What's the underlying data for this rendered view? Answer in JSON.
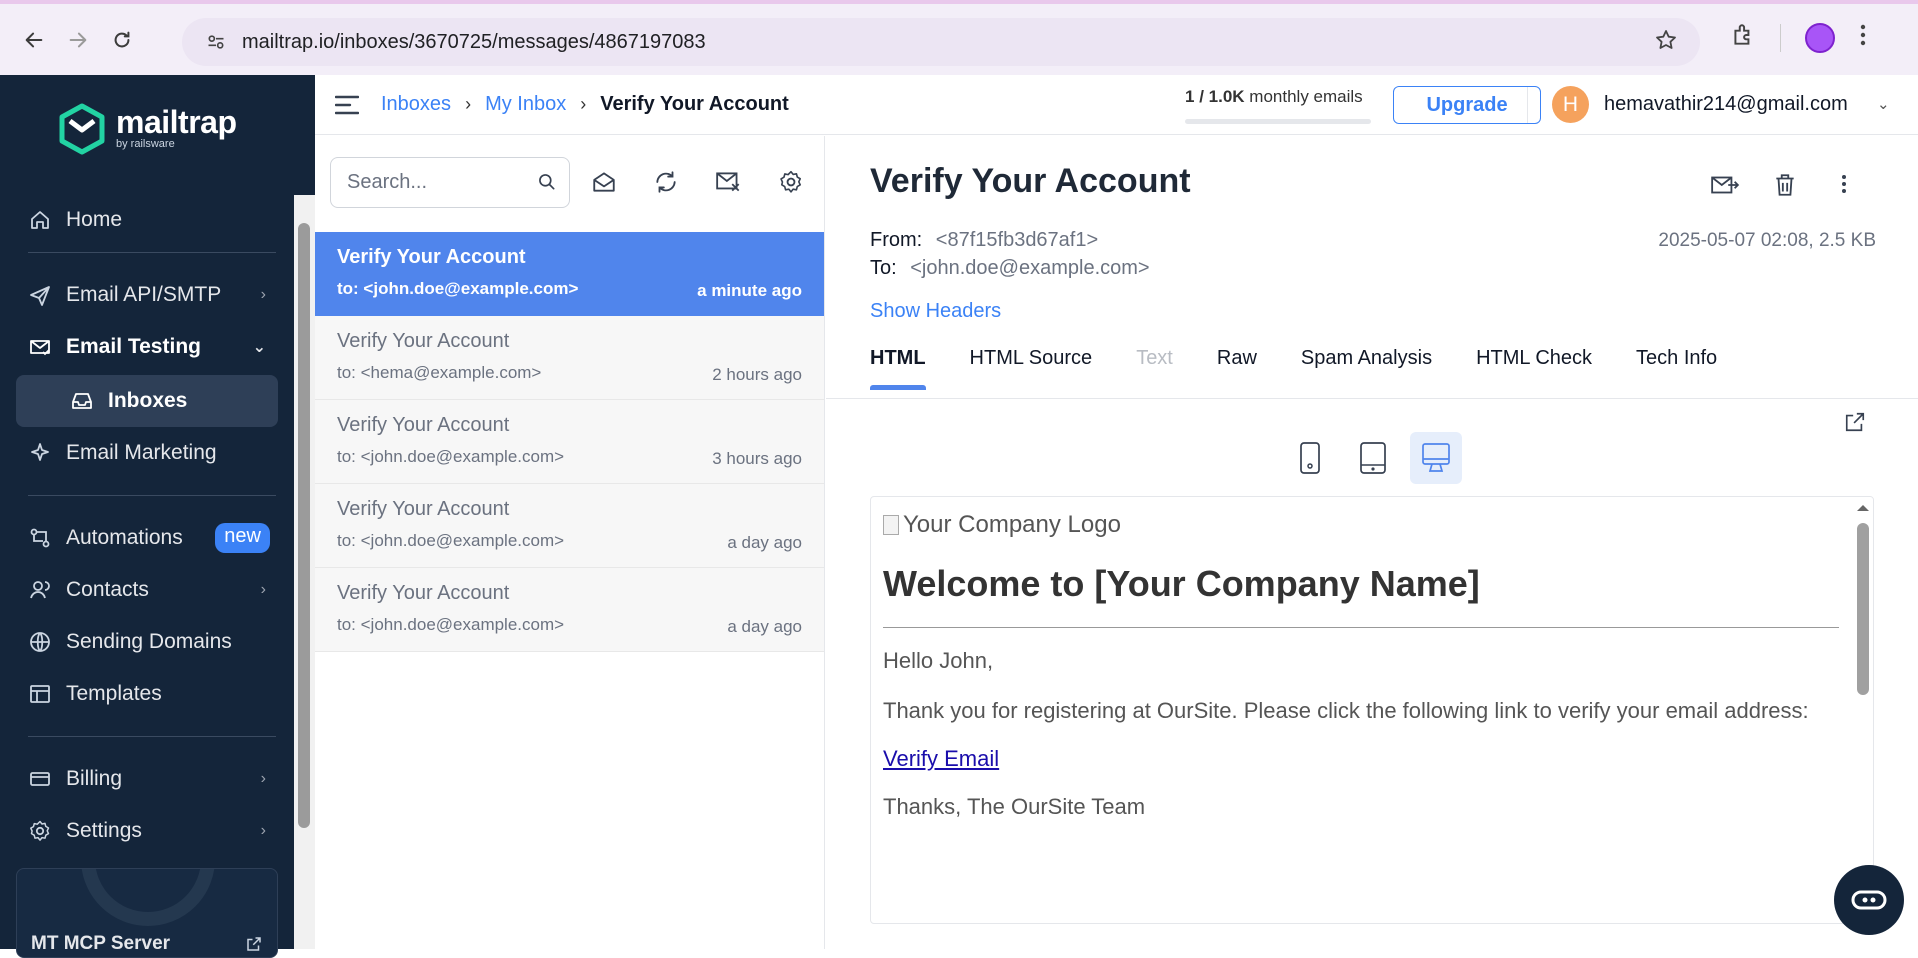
{
  "browser": {
    "url": "mailtrap.io/inboxes/3670725/messages/4867197083"
  },
  "logo": {
    "name": "mailtrap",
    "sub": "by railsware"
  },
  "sidebar": {
    "items": [
      {
        "label": "Home",
        "icon": "home-icon"
      },
      {
        "label": "Email API/SMTP",
        "icon": "send-icon"
      },
      {
        "label": "Email Testing",
        "icon": "email-check-icon"
      },
      {
        "label": "Inboxes",
        "icon": "inbox-icon"
      },
      {
        "label": "Email Marketing",
        "icon": "sparkle-icon"
      },
      {
        "label": "Automations",
        "icon": "automation-icon",
        "badge": "new"
      },
      {
        "label": "Contacts",
        "icon": "contacts-icon"
      },
      {
        "label": "Sending Domains",
        "icon": "globe-icon"
      },
      {
        "label": "Templates",
        "icon": "template-icon"
      },
      {
        "label": "Billing",
        "icon": "card-icon"
      },
      {
        "label": "Settings",
        "icon": "gear-icon"
      }
    ],
    "mcp_label": "MT MCP Server"
  },
  "header": {
    "breadcrumb": [
      "Inboxes",
      "My Inbox",
      "Verify Your Account"
    ],
    "quota_used": "1",
    "quota_total": "1.0K",
    "quota_suffix": "monthly emails",
    "upgrade_label": "Upgrade",
    "user_initial": "H",
    "user_email": "hemavathir214@gmail.com"
  },
  "list": {
    "search_placeholder": "Search...",
    "messages": [
      {
        "subject": "Verify Your Account",
        "to": "to: <john.doe@example.com>",
        "time": "a minute ago"
      },
      {
        "subject": "Verify Your Account",
        "to": "to: <hema@example.com>",
        "time": "2 hours ago"
      },
      {
        "subject": "Verify Your Account",
        "to": "to: <john.doe@example.com>",
        "time": "3 hours ago"
      },
      {
        "subject": "Verify Your Account",
        "to": "to: <john.doe@example.com>",
        "time": "a day ago"
      },
      {
        "subject": "Verify Your Account",
        "to": "to: <john.doe@example.com>",
        "time": "a day ago"
      }
    ]
  },
  "detail": {
    "subject": "Verify Your Account",
    "from_label": "From:",
    "from": "<87f15fb3d67af1>",
    "to_label": "To:",
    "to": "<john.doe@example.com>",
    "meta": "2025-05-07 02:08, 2.5 KB",
    "show_headers": "Show Headers",
    "tabs": [
      "HTML",
      "HTML Source",
      "Text",
      "Raw",
      "Spam Analysis",
      "HTML Check",
      "Tech Info"
    ]
  },
  "preview": {
    "logo_alt": "Your Company Logo",
    "heading": "Welcome to [Your Company Name]",
    "greeting": "Hello John,",
    "body": "Thank you for registering at OurSite. Please click the following link to verify your email address:",
    "link": "Verify Email",
    "signoff": "Thanks, The OurSite Team"
  },
  "colors": {
    "sidebar_bg": "#14253a",
    "accent": "#3b82f6",
    "selected_row": "#5085ec"
  }
}
